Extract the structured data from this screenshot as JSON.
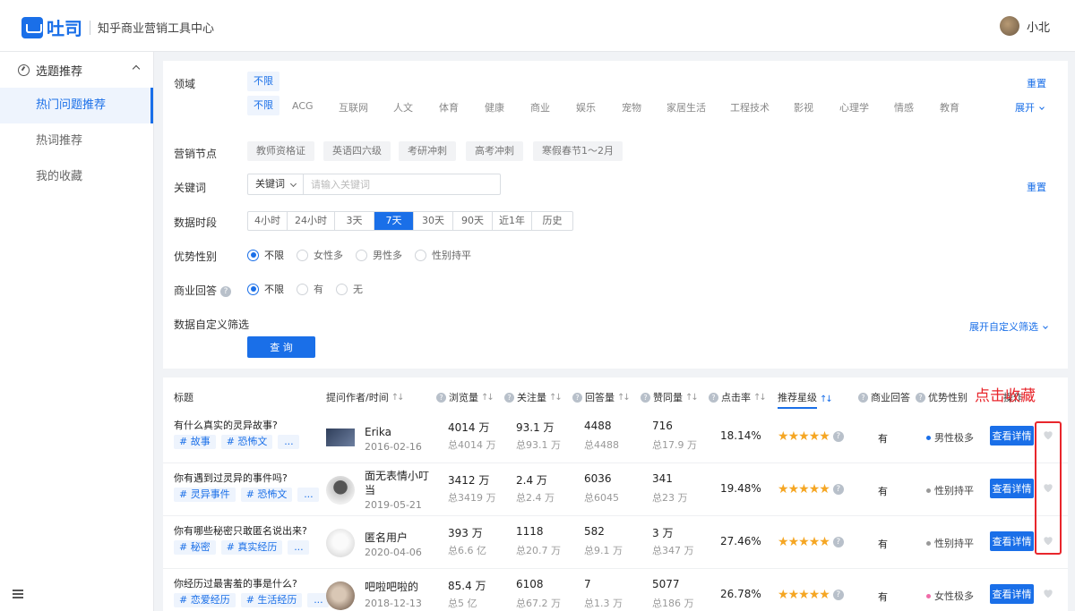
{
  "header": {
    "brand": "吐司",
    "subtitle": "知乎商业营销工具中心",
    "user_name": "小北"
  },
  "sidebar": {
    "section_title": "选题推荐",
    "items": [
      {
        "label": "热门问题推荐",
        "active": true
      },
      {
        "label": "热词推荐",
        "active": false
      },
      {
        "label": "我的收藏",
        "active": false
      }
    ]
  },
  "filters": {
    "domain_label": "领域",
    "domain_unlimited": "不限",
    "domain_options": [
      "不限",
      "ACG",
      "互联网",
      "人文",
      "体育",
      "健康",
      "商业",
      "娱乐",
      "宠物",
      "家居生活",
      "工程技术",
      "影视",
      "心理学",
      "情感",
      "教育"
    ],
    "reset": "重置",
    "expand": "展开",
    "marketing_label": "营销节点",
    "marketing_options": [
      "教师资格证",
      "英语四六级",
      "考研冲刺",
      "高考冲刺",
      "寒假春节1～2月"
    ],
    "keyword_label": "关键词",
    "keyword_select": "关键词",
    "keyword_placeholder": "请输入关键词",
    "keyword_reset": "重置",
    "period_label": "数据时段",
    "period_options": [
      "4小时",
      "24小时",
      "3天",
      "7天",
      "30天",
      "90天",
      "近1年",
      "历史"
    ],
    "period_selected": "7天",
    "gender_label": "优势性别",
    "gender_options": [
      "不限",
      "女性多",
      "男性多",
      "性别持平"
    ],
    "biz_label": "商业回答",
    "biz_help": "?",
    "biz_options": [
      "不限",
      "有",
      "无"
    ],
    "custom_label": "数据自定义筛选",
    "custom_expand": "展开自定义筛选",
    "query_button": "查 询"
  },
  "table": {
    "headers": {
      "title": "标题",
      "author": "提问作者/时间",
      "views": "浏览量",
      "follows": "关注量",
      "answers": "回答量",
      "likes": "赞同量",
      "ctr": "点击率",
      "stars": "推荐星级",
      "biz": "商业回答",
      "gender": "优势性别",
      "action": "操作"
    },
    "help_glyph": "?",
    "sort_glyph": "↑↓",
    "detail_label": "查看详情",
    "rows": [
      {
        "title": "有什么真实的灵异故事?",
        "tags": [
          "# 故事",
          "# 恐怖文",
          "..."
        ],
        "author": "Erika",
        "date": "2016-02-16",
        "views": "4014 万",
        "views_total": "总4014 万",
        "follows": "93.1 万",
        "follows_total": "总93.1 万",
        "answers": "4488",
        "answers_total": "总4488",
        "likes": "716",
        "likes_total": "总17.9 万",
        "ctr": "18.14%",
        "stars": 5,
        "biz": "有",
        "gender": "男性极多",
        "gender_color": "#1a6fe8"
      },
      {
        "title": "你有遇到过灵异的事件吗?",
        "tags": [
          "# 灵异事件",
          "# 恐怖文",
          "..."
        ],
        "author": "面无表情小叮当",
        "date": "2019-05-21",
        "views": "3412 万",
        "views_total": "总3419 万",
        "follows": "2.4 万",
        "follows_total": "总2.4 万",
        "answers": "6036",
        "answers_total": "总6045",
        "likes": "341",
        "likes_total": "总23 万",
        "ctr": "19.48%",
        "stars": 5,
        "biz": "有",
        "gender": "性别持平",
        "gender_color": "#999999"
      },
      {
        "title": "你有哪些秘密只敢匿名说出来?",
        "tags": [
          "# 秘密",
          "# 真实经历",
          "..."
        ],
        "author": "匿名用户",
        "date": "2020-04-06",
        "views": "393 万",
        "views_total": "总6.6 亿",
        "follows": "1118",
        "follows_total": "总20.7 万",
        "answers": "582",
        "answers_total": "总9.1 万",
        "likes": "3 万",
        "likes_total": "总347 万",
        "ctr": "27.46%",
        "stars": 5,
        "biz": "有",
        "gender": "性别持平",
        "gender_color": "#999999"
      },
      {
        "title": "你经历过最害羞的事是什么?",
        "tags": [
          "# 恋爱经历",
          "# 生活经历",
          "..."
        ],
        "author": "吧啦吧啦的",
        "date": "2018-12-13",
        "views": "85.4 万",
        "views_total": "总5 亿",
        "follows": "6108",
        "follows_total": "总67.2 万",
        "answers": "7",
        "answers_total": "总1.3 万",
        "likes": "5077",
        "likes_total": "总186 万",
        "ctr": "26.78%",
        "stars": 5,
        "biz": "有",
        "gender": "女性极多",
        "gender_color": "#f06ba8"
      }
    ]
  },
  "annotation": {
    "text": "点击收藏",
    "color": "#e8262c"
  }
}
